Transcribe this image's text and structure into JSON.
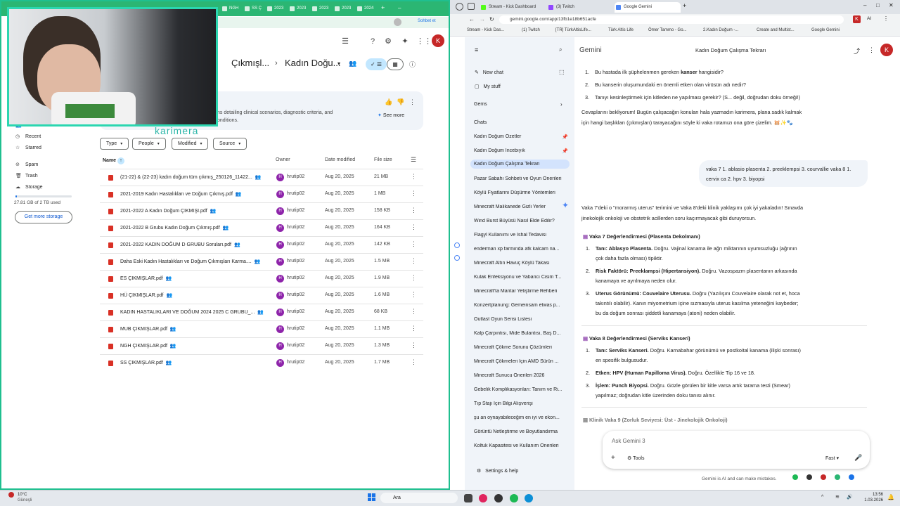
{
  "left_browser": {
    "tabs": [
      "NGH",
      "SS Ç",
      "2023",
      "2023",
      "2023",
      "2023",
      "2024"
    ],
    "chat_button": "Sohbet et",
    "profile_initial": "K"
  },
  "webcam": {
    "watermark": "karimera"
  },
  "drive": {
    "breadcrumb": [
      "Çıkmışl...",
      "Kadın Doğu..."
    ],
    "sidebar": {
      "shared": "Shared with me",
      "recent": "Recent",
      "starred": "Starred",
      "spam": "Spam",
      "trash": "Trash",
      "storage": "Storage",
      "storage_used": "27.81 GB of 2 TB used",
      "get_more_storage": "Get more storage"
    },
    "gemini_summary": {
      "line1": "ns detailing clinical scenarios, diagnostic criteria, and",
      "line2": "onditions.",
      "see_more": "See more"
    },
    "filters": [
      "Type",
      "People",
      "Modified",
      "Source"
    ],
    "columns": {
      "name": "Name",
      "owner": "Owner",
      "date": "Date modified",
      "size": "File size"
    },
    "files": [
      {
        "name": "(21-22) & (22-23) kadın doğum tüm çıkmış_250126_11422...",
        "owner": "hrutip02",
        "date": "Aug 20, 2025",
        "size": "21 MB"
      },
      {
        "name": "2021-2019 Kadın Hastalıkları ve Doğum Çıkmış.pdf",
        "owner": "hrutip02",
        "date": "Aug 20, 2025",
        "size": "1 MB"
      },
      {
        "name": "2021-2022 A Kadın Doğum ÇIKMIŞI.pdf",
        "owner": "hrutip02",
        "date": "Aug 20, 2025",
        "size": "158 KB"
      },
      {
        "name": "2021-2022 B Grubu Kadın Doğum Çıkmış.pdf",
        "owner": "hrutip02",
        "date": "Aug 20, 2025",
        "size": "164 KB"
      },
      {
        "name": "2021-2022 KADIN DOĞUM D GRUBU Soruları.pdf",
        "owner": "hrutip02",
        "date": "Aug 20, 2025",
        "size": "142 KB"
      },
      {
        "name": "Daha Eski Kadın Hastalıkları ve Doğum Çıkmışları Karma....",
        "owner": "hrutip02",
        "date": "Aug 20, 2025",
        "size": "1.5 MB"
      },
      {
        "name": "ES ÇIKMIŞLAR.pdf",
        "owner": "hrutip02",
        "date": "Aug 20, 2025",
        "size": "1.9 MB"
      },
      {
        "name": "HÜ ÇIKMIŞLAR.pdf",
        "owner": "hrutip02",
        "date": "Aug 20, 2025",
        "size": "1.6 MB"
      },
      {
        "name": "KADIN HASTALIKLARI VE DOĞUM 2024 2025 C GRUBU_...",
        "owner": "hrutip02",
        "date": "Aug 20, 2025",
        "size": "68 KB"
      },
      {
        "name": "MUB ÇIKMIŞLAR.pdf",
        "owner": "hrutip02",
        "date": "Aug 20, 2025",
        "size": "1.1 MB"
      },
      {
        "name": "NGH ÇIKMIŞLAR.pdf",
        "owner": "hrutip02",
        "date": "Aug 20, 2025",
        "size": "1.3 MB"
      },
      {
        "name": "SS ÇIKMIŞLAR.pdf",
        "owner": "hrutip02",
        "date": "Aug 20, 2025",
        "size": "1.7 MB"
      }
    ]
  },
  "right_browser": {
    "tabs": [
      "Stream - Kick Dashboard",
      "(3) Twitch",
      "Google Gemini"
    ],
    "url": "gemini.google.com/app/13fb1e18b651acfe",
    "bookmarks": [
      "Stream - Kick Das...",
      "(1) Twitch",
      "[TR] TürkAltisLife...",
      "Türk Altis Life",
      "Ömer Tammo - Go...",
      "2.Kadın Doğum -...",
      "Create and Multist...",
      "Google Gemini"
    ],
    "ai_label": "AI"
  },
  "gemini": {
    "brand": "Gemini",
    "chat_title": "Kadın Doğum Çalışma Tekrarı",
    "new_chat": "New chat",
    "my_stuff": "My stuff",
    "gems": "Gems",
    "chats_header": "Chats",
    "chats": [
      "Kadın Doğum Özetler",
      "Kadın Doğum İncebıyık",
      "Kadın Doğum Çalışma Tekrarı",
      "Pazar Sabahı Sohbeti ve Oyun Önerileri",
      "Köylü Fiyatlarını Düşürme Yöntemleri",
      "Minecraft Malikanede Gizli Yerler",
      "Wind Burst Büyüsü Nasıl Elde Edilir?",
      "Flagyl Kullanımı ve İshal Tedavisi",
      "enderman xp farmında afk kalcam na...",
      "Minecraft Altın Havuç Köylü Takası",
      "Kulak Enfeksiyonu ve Yabancı Cisim T...",
      "Minecraft'ta Mantar Yetiştirme Rehberi",
      "Konzertplanung: Gemeinsam etwas p...",
      "Outlast Oyun Serisi Listesi",
      "Kalp Çarpıntısı, Mide Bulantısı, Baş D...",
      "Minecraft Çökme Sorunu Çözümleri",
      "Minecraft Çökmeleri İçin AMD Sürün ...",
      "Minecraft Sunucu Önerileri 2026",
      "Gebelik Komplikasyonları: Tanım ve Ri...",
      "Tıp Stajı İçin Bilgi Alışverişi",
      "şu an oynayabileceğim en iyi ve ekon...",
      "Görüntü Netleştirme ve Boyutlandırma",
      "Koltuk Kapasitesi ve Kullanım Önerileri"
    ],
    "settings": "Settings & help",
    "questions": [
      {
        "n": "1.",
        "pre": "Bu hastada ilk şüphelenmen gereken ",
        "bold": "kanser",
        "post": " hangisidir?"
      },
      {
        "n": "2.",
        "pre": "Bu kanserin oluşumundaki en önemli etken olan virüsün adı nedir?",
        "bold": "",
        "post": ""
      },
      {
        "n": "3.",
        "pre": "Tanıyı kesinleştirmek için kitleden ne yapılması gerekir? (S... değil, doğrudan doku örneği!)",
        "bold": "",
        "post": ""
      }
    ],
    "waiting_line1": "Cevaplarını bekliyorum! Bugün çalışacağın konuları hala yazmadın karimera, plana sadık kalmak",
    "waiting_line2": "için hangi başlıkları (çıkmışları) tarayacağını söyle ki vaka rotamızı ona göre çizelim. 🐹✨🐾",
    "user_msg_line1": "vaka 7 1. ablasio plasenta 2. preeklempsi 3. courvallie vaka 8 1.",
    "user_msg_line2": "cervix ca 2. hpv 3. biyopsi",
    "reply_intro_1": "Vaka 7'deki o \"morarmış uterus\" terimini ve Vaka 8'deki klinik yaklaşımı çok iyi yakaladın! Sınavda",
    "reply_intro_2": "jinekolojik onkoloji ve obstetrik acillerden soru kaçırmayacak gibi duruyorsun.",
    "vaka7_title": "Vaka 7 Değerlendirmesi (Plasenta Dekolmanı)",
    "vaka7_items": [
      {
        "n": "1.",
        "bold": "Tanı: Ablasyo Plasenta.",
        "l1": " Doğru. Vajinal kanama ile ağrı miktarının uyumsuzluğu (ağrının",
        "l2": "çok daha fazla olması) tipiktir."
      },
      {
        "n": "2.",
        "bold": "Risk Faktörü: Preeklampsi (Hipertansiyon).",
        "l1": " Doğru. Vazospazm plasentanın arkasında",
        "l2": "kanamaya ve ayrılmaya neden olur."
      },
      {
        "n": "3.",
        "bold": "Uterus Görünümü: Couvelaire Uterusu.",
        "l1": " Doğru (Yazılışını Couvelaire olarak not et, hoca",
        "l2": "takıntılı olabilir). Kanın miyometrium içine sızmasıyla uterus kasılma yeteneğini kaybeder;",
        "l3": "bu da doğum sonrası şiddetli kanamaya (atoni) neden olabilir."
      }
    ],
    "vaka8_title": "Vaka 8 Değerlendirmesi (Serviks Kanseri)",
    "vaka8_items": [
      {
        "n": "1.",
        "bold": "Tanı: Serviks Kanseri.",
        "l1": " Doğru. Karnabahar görünümü ve postkoital kanama (ilişki sonrası)",
        "l2": "en spesifik bulgusudur."
      },
      {
        "n": "2.",
        "bold": "Etken: HPV (Human Papilloma Virus).",
        "l1": " Doğru. Özellikle Tip 16 ve 18.",
        "l2": ""
      },
      {
        "n": "3.",
        "bold": "İşlem: Punch Biyopsi.",
        "l1": " Doğru. Gözle görülen bir kitle varsa artık tarama testi (Smear)",
        "l2": "yapılmaz; doğrudan kitle üzerinden doku tanısı alınır."
      }
    ],
    "next_case": "Klinik Vaka 9 (Zorluk Seviyesi: Üst - Jinekolojik Onkoloji)",
    "input_placeholder": "Ask Gemini 3",
    "tools": "Tools",
    "mode": "Fast",
    "disclaimer": "Gemini is AI and can make mistakes."
  },
  "taskbar": {
    "weather_temp": "10°C",
    "weather_desc": "Güneşli",
    "search": "Ara",
    "time": "13:56",
    "date": "1.03.2026"
  }
}
